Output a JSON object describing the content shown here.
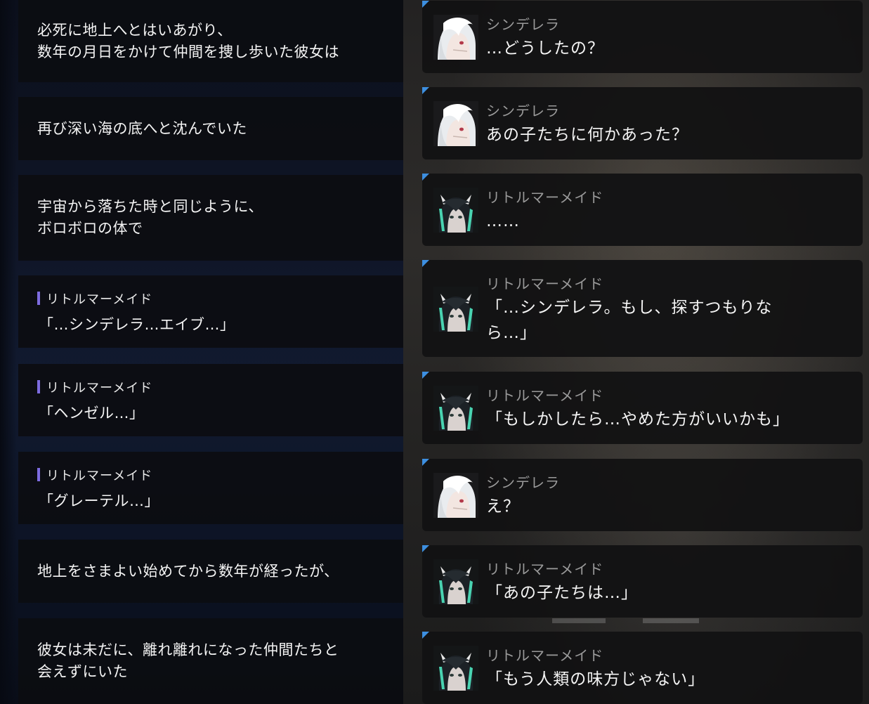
{
  "left_panel": {
    "narration": [
      {
        "text": "必死に地上へとはいあがり、\n数年の月日をかけて仲間を捜し歩いた彼女は"
      },
      {
        "text": "再び深い海の底へと沈んでいた"
      },
      {
        "text": "宇宙から落ちた時と同じように、\nボロボロの体で"
      },
      {
        "speaker": "リトルマーメイド",
        "text": "「…シンデレラ…エイブ…」"
      },
      {
        "speaker": "リトルマーメイド",
        "text": "「ヘンゼル…」"
      },
      {
        "speaker": "リトルマーメイド",
        "text": "「グレーテル…」"
      },
      {
        "text": "地上をさまよい始めてから数年が経ったが、"
      },
      {
        "text": "彼女は未だに、離れ離れになった仲間たちと\n会えずにいた"
      }
    ]
  },
  "right_panel": {
    "messages": [
      {
        "speaker": "シンデレラ",
        "avatar": "cinderella-avatar",
        "text": "…どうしたの？"
      },
      {
        "speaker": "シンデレラ",
        "avatar": "cinderella-avatar",
        "text": "あの子たちに何かあった？"
      },
      {
        "speaker": "リトルマーメイド",
        "avatar": "little-mermaid-avatar",
        "text": "……"
      },
      {
        "speaker": "リトルマーメイド",
        "avatar": "little-mermaid-avatar",
        "text": "「…シンデレラ。もし、探すつもりな\nら…」"
      },
      {
        "speaker": "リトルマーメイド",
        "avatar": "little-mermaid-avatar",
        "text": "「もしかしたら…やめた方がいいかも」"
      },
      {
        "speaker": "シンデレラ",
        "avatar": "cinderella-avatar",
        "text": "え？"
      },
      {
        "speaker": "リトルマーメイド",
        "avatar": "little-mermaid-avatar",
        "text": "「あの子たちは…」"
      },
      {
        "speaker": "リトルマーメイド",
        "avatar": "little-mermaid-avatar",
        "text": "「もう人類の味方じゃない」"
      }
    ]
  },
  "colors": {
    "speaker_bar": "#7d6ce0",
    "corner_accent": "#3d8fe0",
    "card_bg": "#121213"
  }
}
